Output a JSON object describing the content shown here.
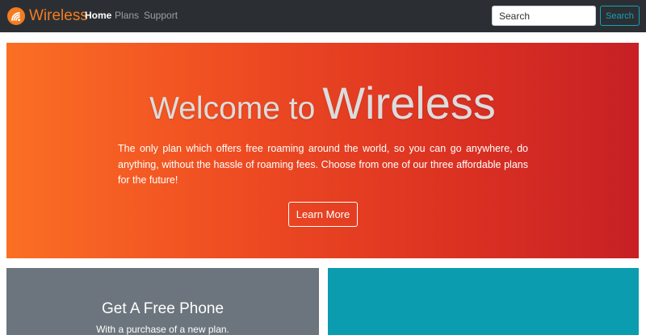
{
  "brand": {
    "name": "Wireless",
    "color": "#f47c20",
    "icon": "wifi-signal-icon"
  },
  "nav": {
    "items": [
      {
        "label": "Home",
        "active": true
      },
      {
        "label": "Plans",
        "active": false
      },
      {
        "label": "Support",
        "active": false
      }
    ]
  },
  "search": {
    "placeholder": "Search",
    "button_label": "Search",
    "accent": "#17a2b8"
  },
  "hero": {
    "title_prefix": "Welcome to",
    "title_main": "Wireless",
    "text": "The only plan which offers free roaming around the world, so you can go anywhere, do anything, without the hassle of roaming fees. Choose from one of our three affordable plans for the future!",
    "button_label": "Learn More",
    "gradient_start": "#fb6f24",
    "gradient_end": "#c72025"
  },
  "cards": [
    {
      "title": "Get A Free Phone",
      "subtitle": "With a purchase of a new plan.",
      "color": "#6c757d"
    },
    {
      "color": "#0b9caf"
    }
  ]
}
